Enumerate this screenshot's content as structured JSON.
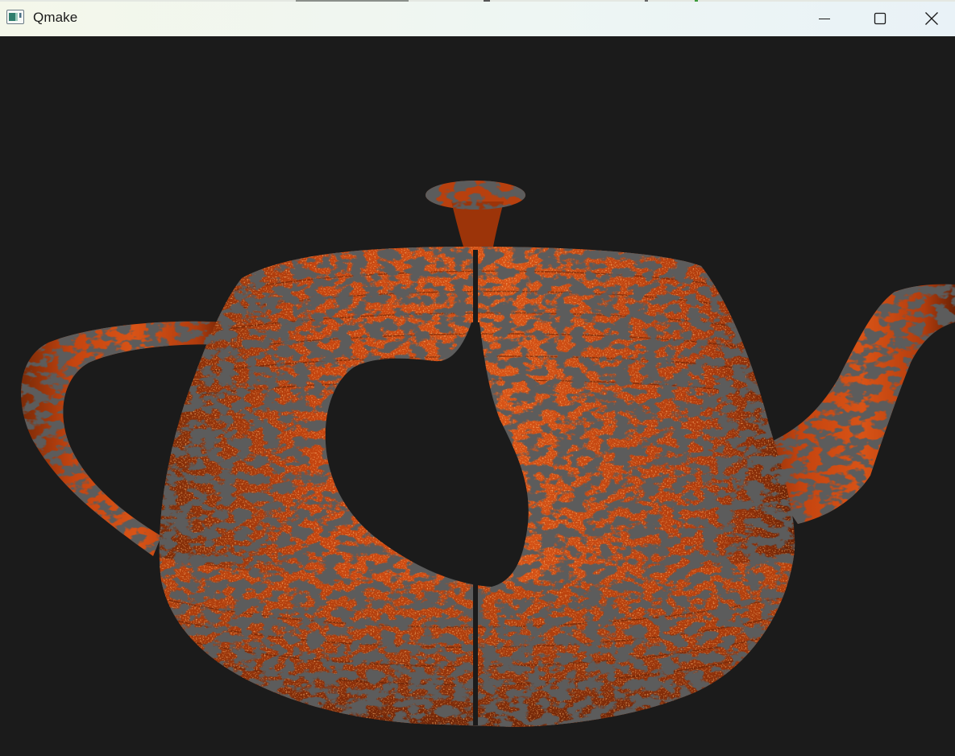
{
  "window": {
    "title": "Qmake",
    "app_icon": "qt-window-icon",
    "controls": {
      "minimize_icon": "minimize-icon",
      "maximize_icon": "maximize-icon",
      "close_icon": "close-icon"
    }
  },
  "scene": {
    "object": "teapot",
    "background_color": "#1b1b1b",
    "base_color": "#c8430f",
    "highlight_color": "#e8601c",
    "shadow_color": "#6e2406"
  }
}
